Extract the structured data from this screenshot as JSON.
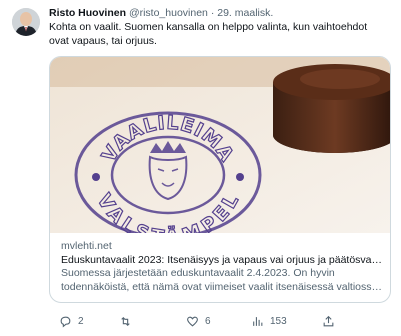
{
  "tweet": {
    "author_name": "Risto Huovinen",
    "handle": "@risto_huovinen",
    "separator": "·",
    "date": "29. maalisk.",
    "text": "Kohta on vaalit. Suomen kansalla on helppo valinta, kun vaihtoehdot ovat vapaus, tai orjuus."
  },
  "card": {
    "domain": "mvlehti.net",
    "title": "Eduskuntavaalit 2023: Itsenäisyys ja vapaus vai orjuus ja päätösvall…",
    "description": "Suomessa järjestetään eduskuntavaalit 2.4.2023. On hyvin todennäköistä, että nämä ovat viimeiset vaalit itsenäisessä valtioss…",
    "image": {
      "stamp_text_top": "VAALILEIMA",
      "stamp_text_bottom": "VALSTÄMPEL"
    }
  },
  "actions": {
    "reply_count": "2",
    "retweet_count": "",
    "like_count": "6",
    "view_count": "153"
  },
  "icons": [
    "avatar",
    "reply-icon",
    "retweet-icon",
    "like-icon",
    "views-icon",
    "share-icon"
  ],
  "colors": {
    "secondary_text": "#536471",
    "border": "#cfd9de",
    "stamp_ink": "#54408e"
  }
}
